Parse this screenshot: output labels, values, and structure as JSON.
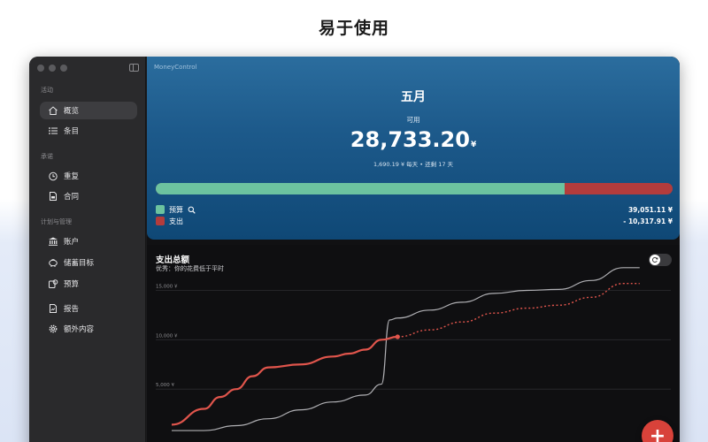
{
  "headline": "易于使用",
  "sidebar": {
    "sections": [
      {
        "label": "活动",
        "items": [
          {
            "label": "概览",
            "icon": "house-icon",
            "active": true
          },
          {
            "label": "条目",
            "icon": "list-icon",
            "active": false
          }
        ]
      },
      {
        "label": "承诺",
        "items": [
          {
            "label": "重复",
            "icon": "recurring-icon",
            "active": false
          },
          {
            "label": "合同",
            "icon": "contract-icon",
            "active": false
          }
        ]
      },
      {
        "label": "计划与管理",
        "items": [
          {
            "label": "账户",
            "icon": "bank-icon",
            "active": false
          },
          {
            "label": "储蓄目标",
            "icon": "piggy-bank-icon",
            "active": false
          },
          {
            "label": "预算",
            "icon": "budget-icon",
            "active": false
          },
          {
            "label": "报告",
            "icon": "report-icon",
            "active": false
          },
          {
            "label": "额外内容",
            "icon": "gear-icon",
            "active": false
          }
        ]
      }
    ]
  },
  "summary": {
    "app_title": "MoneyControl",
    "month": "五月",
    "available_label": "可用",
    "available_amount": "28,733.20",
    "currency": "¥",
    "subline": "1,690.19 ¥ 每天 • 还剩 17 天",
    "budget_fraction": 0.7907,
    "budget_label": "预算",
    "budget_value": "39,051.11 ¥",
    "expense_label": "支出",
    "expense_value": "- 10,317.91 ¥",
    "colors": {
      "budget": "#6cc39f",
      "expense": "#b33c3c"
    }
  },
  "chart_card": {
    "title": "支出总额",
    "subtitle": "优秀：你的花费低于平时",
    "toggle_icon": "refresh-icon",
    "fab_label": "+"
  },
  "chart_data": {
    "type": "line",
    "yticks": [
      "15,000 ¥",
      "10,000 ¥",
      "5,000 ¥"
    ],
    "ytick_values": [
      15000,
      10000,
      5000
    ],
    "ylim": [
      0,
      18000
    ],
    "xlim": [
      1,
      31
    ],
    "series": [
      {
        "color": "#b0b0b4",
        "style": "solid",
        "x": [
          1,
          3,
          5,
          7,
          9,
          11,
          13,
          14,
          14.5,
          15,
          17,
          19,
          21,
          23,
          25,
          27,
          29,
          30
        ],
        "values": [
          800,
          800,
          1300,
          2000,
          2900,
          3700,
          4400,
          5500,
          12000,
          12200,
          13000,
          13800,
          14700,
          15000,
          15100,
          16000,
          17300,
          17300
        ]
      },
      {
        "color": "#e0554c",
        "style": "solid",
        "x": [
          1,
          3,
          4,
          5,
          6,
          7,
          9,
          11,
          12,
          13,
          14,
          15
        ],
        "values": [
          1400,
          3000,
          4200,
          5000,
          6300,
          7200,
          7500,
          8300,
          8600,
          9000,
          10000,
          10300
        ]
      },
      {
        "color": "#e0554c",
        "style": "dashed",
        "x": [
          15,
          17,
          19,
          21,
          23,
          25,
          27,
          29,
          30
        ],
        "values": [
          10300,
          11000,
          11800,
          12700,
          13200,
          13500,
          14300,
          15700,
          15700
        ]
      }
    ],
    "marker": {
      "x": 15,
      "value": 10300
    }
  }
}
